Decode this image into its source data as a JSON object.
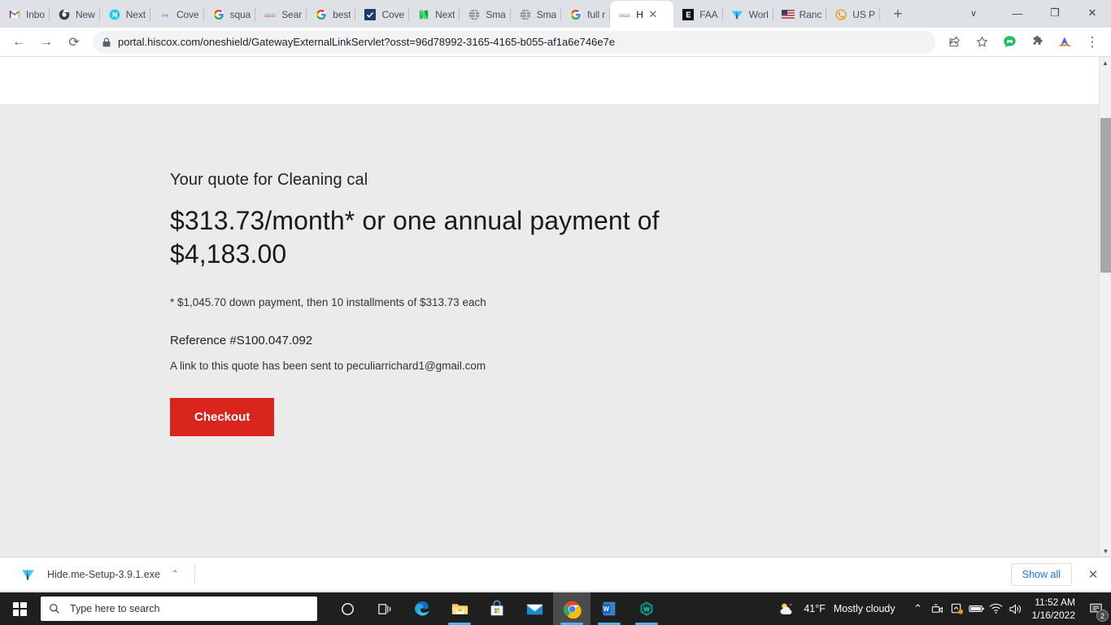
{
  "browser": {
    "tabs": [
      {
        "title": "Inbo",
        "icon": "gmail-icon",
        "active": false
      },
      {
        "title": "New",
        "icon": "chrome-dark-icon",
        "active": false
      },
      {
        "title": "Next",
        "icon": "next-insurance-icon",
        "active": false
      },
      {
        "title": "Cove",
        "icon": "cw-icon",
        "active": false
      },
      {
        "title": "squa",
        "icon": "google-icon",
        "active": false
      },
      {
        "title": "Sear",
        "icon": "hiscox-icon",
        "active": false
      },
      {
        "title": "best",
        "icon": "google-icon",
        "active": false
      },
      {
        "title": "Cove",
        "icon": "checkmark-blue-icon",
        "active": false
      },
      {
        "title": "Next",
        "icon": "next-green-icon",
        "active": false
      },
      {
        "title": "Sma",
        "icon": "globe-gray-icon",
        "active": false
      },
      {
        "title": "Sma",
        "icon": "globe-gray-icon",
        "active": false
      },
      {
        "title": "full r",
        "icon": "google-icon",
        "active": false
      },
      {
        "title": "H",
        "icon": "hiscox-icon",
        "active": true
      },
      {
        "title": "FAA",
        "icon": "faa-icon",
        "active": false
      },
      {
        "title": "Worl",
        "icon": "hideme-icon",
        "active": false
      },
      {
        "title": "Ranc",
        "icon": "usflag-icon",
        "active": false
      },
      {
        "title": "US P",
        "icon": "phone-orange-icon",
        "active": false
      }
    ],
    "new_tab_label": "+",
    "close_tab_label": "✕",
    "window_controls": {
      "chevron": "∨",
      "minimize": "—",
      "maximize": "❐",
      "close": "✕"
    },
    "toolbar": {
      "back_label": "←",
      "forward_label": "→",
      "reload_label": "⟳",
      "lock_label": "🔒",
      "url": "portal.hiscox.com/oneshield/GatewayExternalLinkServlet?osst=96d78992-3165-4165-b055-af1a6e746e7e",
      "share_icon": "share-icon",
      "bookmark_icon": "star-icon",
      "chat_icon": "chat-bubble-icon",
      "extensions_icon": "puzzle-icon",
      "profile_icon": "extension-arrow-icon",
      "menu_icon": "three-dot-menu-icon",
      "menu_label": "⋮"
    }
  },
  "page": {
    "subtitle": "Your quote for Cleaning cal",
    "headline": "$313.73/month* or one annual payment of $4,183.00",
    "footnote": "* $1,045.70 down payment, then 10 installments of $313.73 each",
    "reference": "Reference #S100.047.092",
    "email_note": "A link to this quote has been sent to peculiarrichard1@gmail.com",
    "checkout_label": "Checkout",
    "background_color": "#ebebeb",
    "accent_color": "#d9251c"
  },
  "download_shelf": {
    "file_name": "Hide.me-Setup-3.9.1.exe",
    "caret_label": "ⱏ",
    "show_all_label": "Show all",
    "close_label": "✕"
  },
  "taskbar": {
    "start_label": "start-button",
    "search_placeholder": "Type here to search",
    "search_icon": "magnifier-icon",
    "apps": [
      {
        "name": "cortana-icon",
        "active": false,
        "running": false
      },
      {
        "name": "task-view-icon",
        "active": false,
        "running": false
      },
      {
        "name": "edge-icon",
        "active": false,
        "running": false
      },
      {
        "name": "file-explorer-icon",
        "active": false,
        "running": true
      },
      {
        "name": "microsoft-store-icon",
        "active": false,
        "running": false
      },
      {
        "name": "mail-icon",
        "active": false,
        "running": false
      },
      {
        "name": "chrome-icon",
        "active": true,
        "running": true
      },
      {
        "name": "word-icon",
        "active": false,
        "running": true
      },
      {
        "name": "wondershare-icon",
        "active": false,
        "running": true
      }
    ],
    "weather": {
      "icon": "partly-cloudy-icon",
      "temperature": "41°F",
      "condition": "Mostly cloudy"
    },
    "tray": {
      "overflow_label": "ⱏ",
      "camera_icon": "camera-icon",
      "onedrive_icon": "onedrive-sync-icon",
      "battery_icon": "battery-icon",
      "wifi_icon": "wifi-icon",
      "volume_icon": "volume-icon"
    },
    "clock": {
      "time": "11:52 AM",
      "date": "1/16/2022"
    },
    "notifications": {
      "icon": "notification-icon",
      "count": "2"
    }
  }
}
